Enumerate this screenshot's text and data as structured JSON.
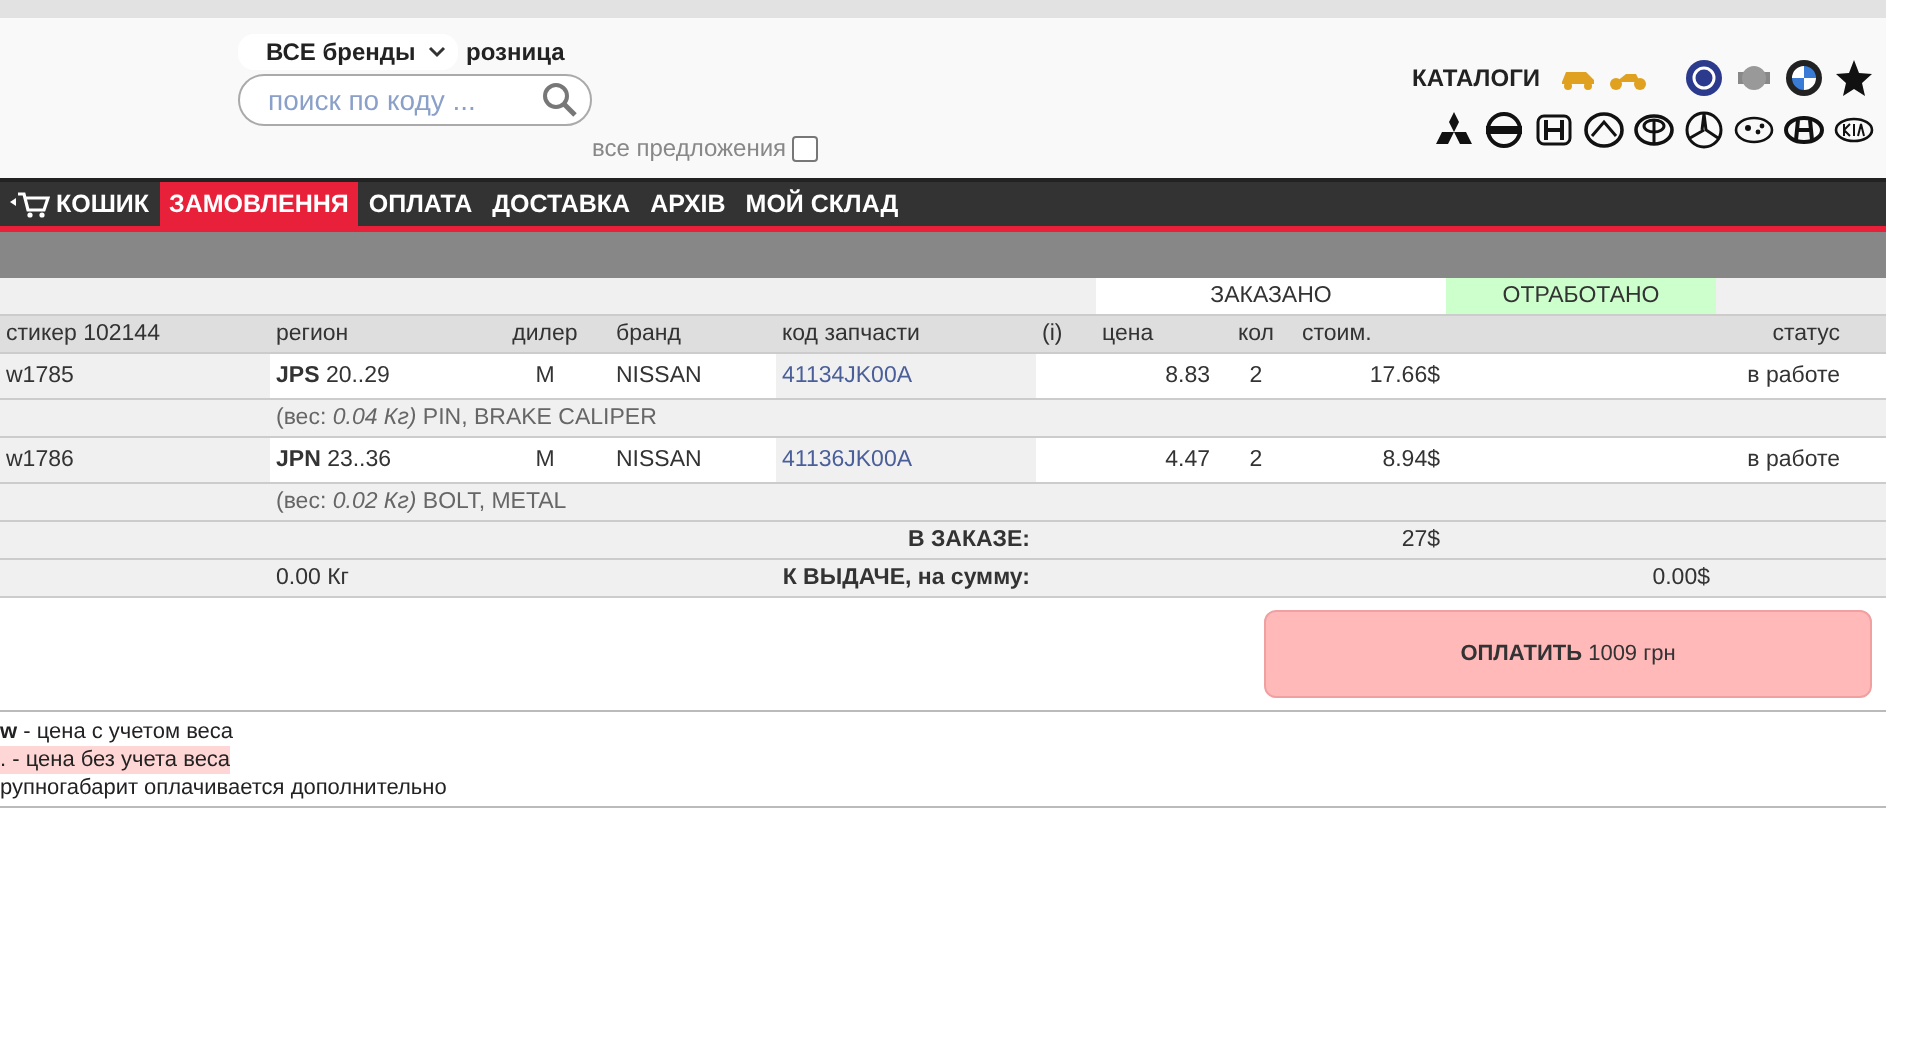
{
  "brand_filter": {
    "value": "ВСЕ бренды",
    "price_type": "розница"
  },
  "search": {
    "placeholder": "поиск по коду ..."
  },
  "all_offers": {
    "label": "все предложения",
    "checked": false
  },
  "catalogs": {
    "label": "КАТАЛОГИ"
  },
  "nav": [
    {
      "label": "КОШИК",
      "kind": "cart",
      "selected": false
    },
    {
      "label": "ЗАМОВЛЕННЯ",
      "kind": "text",
      "selected": true
    },
    {
      "label": "ОПЛАТА",
      "kind": "text",
      "selected": false
    },
    {
      "label": "ДОСТАВКА",
      "kind": "text",
      "selected": false
    },
    {
      "label": "АРХІВ",
      "kind": "text",
      "selected": false
    },
    {
      "label": "МОЙ СКЛАД",
      "kind": "text",
      "selected": false
    }
  ],
  "groups": {
    "ordered": "ЗАКАЗАНО",
    "processed": "ОТРАБОТАНО"
  },
  "columns": [
    "стикер 102144",
    "регион",
    "дилер",
    "бранд",
    "код запчасти",
    "(i)",
    "цена",
    "кол",
    "стоим.",
    "",
    "статус"
  ],
  "rows": [
    {
      "sticker": "w1785",
      "region": "**JPS** 20..29",
      "dealer": "M",
      "brand": "NISSAN",
      "code": "41134JK00A",
      "price": "8.83",
      "qty": "2",
      "cost": "17.66$",
      "status": "в работе",
      "description": "(вес: *0.04 Кг)* PIN, BRAKE CALIPER"
    },
    {
      "sticker": "w1786",
      "region": "**JPN** 23..36",
      "dealer": "M",
      "brand": "NISSAN",
      "code": "41136JK00A",
      "price": "4.47",
      "qty": "2",
      "cost": "8.94$",
      "status": "в работе",
      "description": "(вес: *0.02 Кг)* BOLT, METAL"
    }
  ],
  "totals": {
    "order_label": "В ЗАКАЗЕ:",
    "order_sum": "27$",
    "weight": "0.00 Кг",
    "issue_label": "К ВЫДАЧЕ, на сумму:",
    "issue_sum": "0.00$"
  },
  "pay_button": {
    "label": "ОПЛАТИТЬ",
    "amount": "1009 грн"
  },
  "legend": [
    "**w** - цена с учетом веса",
    ". - цена без учета веса",
    "рупногабарит оплачивается дополнительно"
  ]
}
